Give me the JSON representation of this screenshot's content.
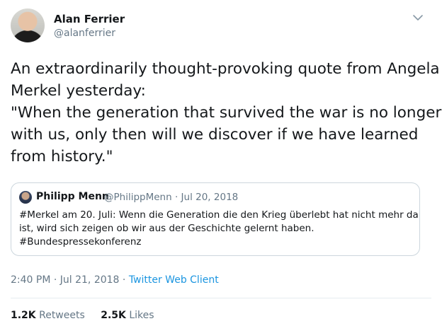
{
  "author": {
    "name": "Alan Ferrier",
    "handle": "@alanferrier"
  },
  "tweet": {
    "lines": [
      "An extraordinarily thought-provoking quote from Angela",
      "Merkel yesterday:",
      "\"When the generation that survived the war is no longer",
      "with us, only then will we discover if we have learned",
      "from history.\""
    ]
  },
  "quoted": {
    "name": "Philipp Menn",
    "handle": "@PhilippMenn",
    "separator": "·",
    "date": "Jul 20, 2018",
    "lines": [
      "#Merkel am 20. Juli: Wenn die Generation die den Krieg überlebt hat nicht mehr da",
      "ist, wird sich zeigen ob wir aus der Geschichte gelernt haben.",
      "#Bundespressekonferenz"
    ]
  },
  "meta": {
    "time_date": "2:40 PM · Jul 21, 2018",
    "separator": "·",
    "client": "Twitter Web Client"
  },
  "stats": {
    "retweets_count": "1.2K",
    "retweets_label": "Retweets",
    "likes_count": "2.5K",
    "likes_label": "Likes"
  },
  "colors": {
    "link": "#1b95e0",
    "secondary_text": "#657786",
    "border": "#ccd6dd"
  },
  "icons": {
    "menu": "chevron-down-icon"
  }
}
